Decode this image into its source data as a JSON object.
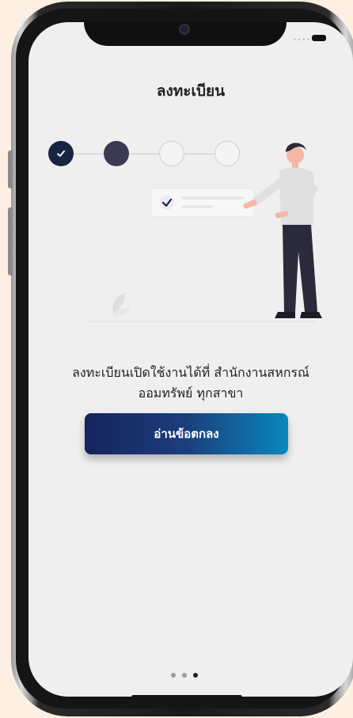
{
  "header": {
    "title": "ลงทะเบียน"
  },
  "stepper": {
    "steps": [
      {
        "state": "completed"
      },
      {
        "state": "current"
      },
      {
        "state": "upcoming"
      },
      {
        "state": "upcoming"
      }
    ]
  },
  "message": {
    "line1": "ลงทะเบียนเปิดใช้งานได้ที่ สำนักงานสหกรณ์",
    "line2": "ออมทรัพย์ ทุกสาขา"
  },
  "actions": {
    "read_terms_label": "อ่านข้อตกลง"
  },
  "pager": {
    "count": 3,
    "active_index": 2
  },
  "colors": {
    "primary_dark": "#152542",
    "current_step": "#3b3a52",
    "button_start": "#16235e",
    "button_end": "#0887be"
  },
  "icons": [
    "check-icon",
    "person-illustration",
    "leaf-icon"
  ]
}
